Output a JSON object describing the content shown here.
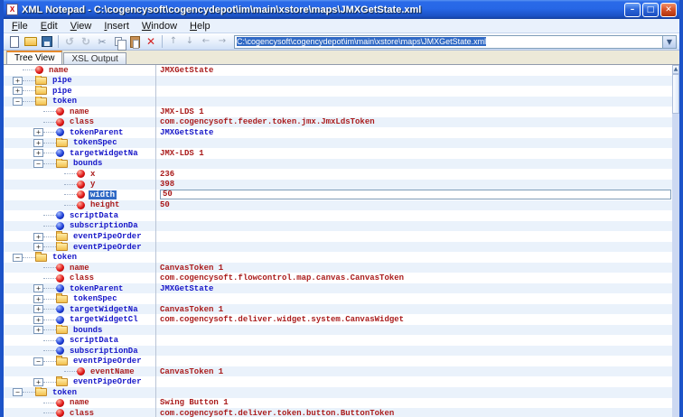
{
  "window": {
    "title": "XML Notepad - C:\\cogencysoft\\cogencydepot\\im\\main\\xstore\\maps\\JMXGetState.xml",
    "controls": {
      "minimize": "–",
      "maximize": "□",
      "close": "✕"
    }
  },
  "menu": {
    "items": [
      "File",
      "Edit",
      "View",
      "Insert",
      "Window",
      "Help"
    ]
  },
  "toolbar": {
    "buttons": [
      {
        "name": "new-document",
        "glyph": ""
      },
      {
        "name": "open-file",
        "glyph": ""
      },
      {
        "name": "save",
        "glyph": "",
        "separator_after": true
      },
      {
        "name": "undo",
        "glyph": "↺"
      },
      {
        "name": "redo",
        "glyph": "↻"
      },
      {
        "name": "cut",
        "glyph": "✂"
      },
      {
        "name": "copy",
        "glyph": ""
      },
      {
        "name": "paste",
        "glyph": ""
      },
      {
        "name": "delete",
        "glyph": "✕",
        "separator_after": true
      },
      {
        "name": "nudge-up",
        "glyph": "↑"
      },
      {
        "name": "nudge-down",
        "glyph": "↓"
      },
      {
        "name": "nudge-left",
        "glyph": "←"
      },
      {
        "name": "nudge-right",
        "glyph": "→"
      }
    ],
    "address_value": "C:\\cogencysoft\\cogencydepot\\im\\main\\xstore\\maps\\JMXGetState.xml",
    "address_selected": true
  },
  "tabs": [
    {
      "label": "Tree View",
      "active": true
    },
    {
      "label": "XSL Output",
      "active": false
    }
  ],
  "tree": {
    "rows": [
      {
        "indent": 1,
        "expander": "",
        "icon": "red-dot",
        "label": "name",
        "value": "JMXGetState",
        "value_color": "red"
      },
      {
        "indent": 1,
        "expander": "+",
        "icon": "folder",
        "label": "pipe",
        "value": ""
      },
      {
        "indent": 1,
        "expander": "+",
        "icon": "folder",
        "label": "pipe",
        "value": ""
      },
      {
        "indent": 1,
        "expander": "-",
        "icon": "folder",
        "label": "token",
        "value": ""
      },
      {
        "indent": 2,
        "expander": "",
        "icon": "red-dot",
        "label": "name",
        "value": "JMX-LDS 1",
        "value_color": "red"
      },
      {
        "indent": 2,
        "expander": "",
        "icon": "red-dot",
        "label": "class",
        "value": "com.cogencysoft.feeder.token.jmx.JmxLdsToken",
        "value_color": "red"
      },
      {
        "indent": 2,
        "expander": "+",
        "icon": "blue-dot",
        "label": "tokenParent",
        "value": "JMXGetState",
        "value_color": "blue"
      },
      {
        "indent": 2,
        "expander": "+",
        "icon": "folder",
        "label": "tokenSpec",
        "value": ""
      },
      {
        "indent": 2,
        "expander": "+",
        "icon": "blue-dot",
        "label": "targetWidgetNa",
        "value": "JMX-LDS 1",
        "value_color": "red"
      },
      {
        "indent": 2,
        "expander": "-",
        "icon": "folder",
        "label": "bounds",
        "value": ""
      },
      {
        "indent": 3,
        "expander": "",
        "icon": "red-dot",
        "label": "x",
        "value": "236",
        "value_color": "red"
      },
      {
        "indent": 3,
        "expander": "",
        "icon": "red-dot",
        "label": "y",
        "value": "398",
        "value_color": "red"
      },
      {
        "indent": 3,
        "expander": "",
        "icon": "red-dot",
        "label": "width",
        "value": "50",
        "value_color": "red",
        "selected": true,
        "editing": true
      },
      {
        "indent": 3,
        "expander": "",
        "icon": "red-dot",
        "label": "height",
        "value": "50",
        "value_color": "red"
      },
      {
        "indent": 2,
        "expander": "",
        "icon": "blue-dot",
        "label": "scriptData",
        "value": ""
      },
      {
        "indent": 2,
        "expander": "",
        "icon": "blue-dot",
        "label": "subscriptionDa",
        "value": ""
      },
      {
        "indent": 2,
        "expander": "+",
        "icon": "folder",
        "label": "eventPipeOrder",
        "value": ""
      },
      {
        "indent": 2,
        "expander": "+",
        "icon": "folder",
        "label": "eventPipeOrder",
        "value": ""
      },
      {
        "indent": 1,
        "expander": "-",
        "icon": "folder",
        "label": "token",
        "value": ""
      },
      {
        "indent": 2,
        "expander": "",
        "icon": "red-dot",
        "label": "name",
        "value": "CanvasToken 1",
        "value_color": "red"
      },
      {
        "indent": 2,
        "expander": "",
        "icon": "red-dot",
        "label": "class",
        "value": "com.cogencysoft.flowcontrol.map.canvas.CanvasToken",
        "value_color": "red"
      },
      {
        "indent": 2,
        "expander": "+",
        "icon": "blue-dot",
        "label": "tokenParent",
        "value": "JMXGetState",
        "value_color": "blue"
      },
      {
        "indent": 2,
        "expander": "+",
        "icon": "folder",
        "label": "tokenSpec",
        "value": ""
      },
      {
        "indent": 2,
        "expander": "+",
        "icon": "blue-dot",
        "label": "targetWidgetNa",
        "value": "CanvasToken 1",
        "value_color": "red"
      },
      {
        "indent": 2,
        "expander": "+",
        "icon": "blue-dot",
        "label": "targetWidgetCl",
        "value": "com.cogencysoft.deliver.widget.system.CanvasWidget",
        "value_color": "red"
      },
      {
        "indent": 2,
        "expander": "+",
        "icon": "folder",
        "label": "bounds",
        "value": ""
      },
      {
        "indent": 2,
        "expander": "",
        "icon": "blue-dot",
        "label": "scriptData",
        "value": ""
      },
      {
        "indent": 2,
        "expander": "",
        "icon": "blue-dot",
        "label": "subscriptionDa",
        "value": ""
      },
      {
        "indent": 2,
        "expander": "-",
        "icon": "folder",
        "label": "eventPipeOrder",
        "value": ""
      },
      {
        "indent": 3,
        "expander": "",
        "icon": "red-dot",
        "label": "eventName",
        "value": "CanvasToken 1",
        "value_color": "red"
      },
      {
        "indent": 2,
        "expander": "+",
        "icon": "folder",
        "label": "eventPipeOrder",
        "value": ""
      },
      {
        "indent": 1,
        "expander": "-",
        "icon": "folder",
        "label": "token",
        "value": ""
      },
      {
        "indent": 2,
        "expander": "",
        "icon": "red-dot",
        "label": "name",
        "value": "Swing Button 1",
        "value_color": "red"
      },
      {
        "indent": 2,
        "expander": "",
        "icon": "red-dot",
        "label": "class",
        "value": "com.cogencysoft.deliver.token.button.ButtonToken",
        "value_color": "red"
      }
    ]
  },
  "colors": {
    "frame_blue": "#1c53c8",
    "attribute_red": "#aa1c1c",
    "element_blue": "#1616c8",
    "selection_blue": "#316ac5",
    "row_stripe": "#eaf2fb"
  }
}
